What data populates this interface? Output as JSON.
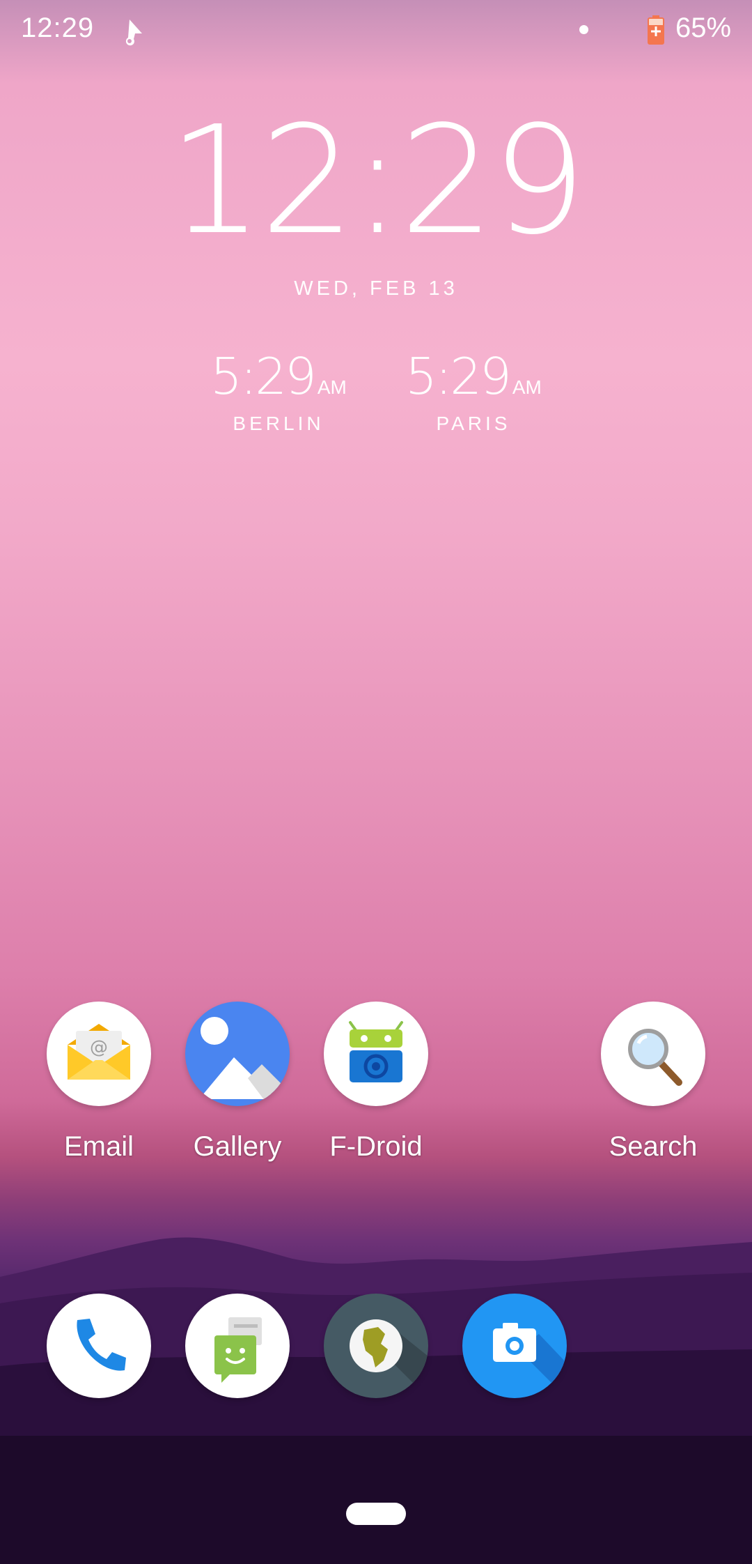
{
  "status_bar": {
    "time": "12:29",
    "battery_percent": "65%"
  },
  "clock_widget": {
    "time": "12:29",
    "date": "WED, FEB 13",
    "world_clocks": [
      {
        "time": "5:29",
        "ampm": "AM",
        "city": "BERLIN"
      },
      {
        "time": "5:29",
        "ampm": "AM",
        "city": "PARIS"
      }
    ]
  },
  "home_apps": [
    {
      "label": "Email",
      "icon": "email-icon"
    },
    {
      "label": "Gallery",
      "icon": "gallery-icon"
    },
    {
      "label": "F-Droid",
      "icon": "fdroid-icon"
    },
    {
      "label": "Search",
      "icon": "search-icon"
    }
  ],
  "dock_apps": [
    {
      "icon": "phone-icon"
    },
    {
      "icon": "messaging-icon"
    },
    {
      "icon": "browser-icon"
    },
    {
      "icon": "camera-icon"
    }
  ],
  "colors": {
    "gallery_blue": "#4a85f0",
    "camera_blue": "#2196f3",
    "fdroid_green": "#a8d23a",
    "browser_dark": "#455a64"
  }
}
